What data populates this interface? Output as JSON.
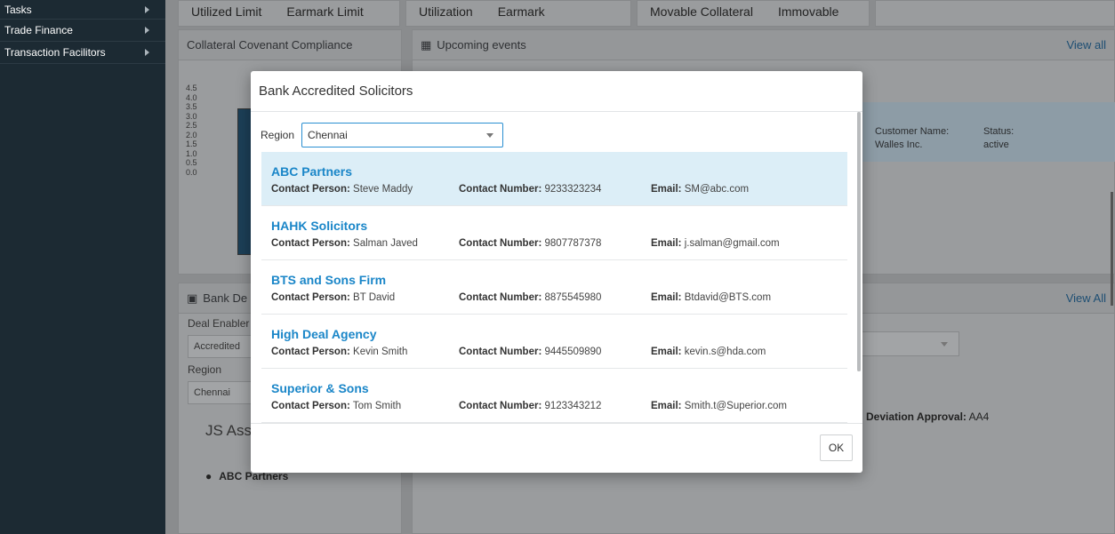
{
  "sidebar": {
    "items": [
      {
        "label": "Tasks"
      },
      {
        "label": "Trade Finance"
      },
      {
        "label": "Transaction Facilitors"
      }
    ]
  },
  "dashboard": {
    "tab_groups": [
      [
        "Utilized Limit",
        "Earmark Limit"
      ],
      [
        "Utilization",
        "Earmark"
      ],
      [
        "Movable Collateral",
        "Immovable"
      ]
    ],
    "collateral_panel_title": "Collateral Covenant Compliance",
    "chart_ticks": [
      "4.5",
      "4.0",
      "3.5",
      "3.0",
      "2.5",
      "2.0",
      "1.5",
      "1.0",
      "0.5",
      "0.0"
    ],
    "events_title": "Upcoming events",
    "events_view_all": "View all",
    "customer_name_label": "Customer Name:",
    "customer_name_value": "Walles Inc.",
    "status_label": "Status:",
    "status_value": "active",
    "bank_deals_title": "Bank De",
    "view_all_2": "View All",
    "deal_enabler_label": "Deal Enabler",
    "deal_enabler_value": "Accredited",
    "region_label": "Region",
    "region_value": "Chennai",
    "js_assoc": "JS Assoc",
    "abc_partners": "ABC Partners",
    "deviation_label": "Deviation Approval:",
    "deviation_value": "AA4"
  },
  "modal": {
    "title": "Bank Accredited Solicitors",
    "region_label": "Region",
    "region_selected": "Chennai",
    "contact_person_label": "Contact Person:",
    "contact_number_label": "Contact Number:",
    "email_label": "Email:",
    "ok_label": "OK",
    "solicitors": [
      {
        "name": "ABC Partners",
        "person": "Steve Maddy",
        "number": "9233323234",
        "email": "SM@abc.com"
      },
      {
        "name": "HAHK Solicitors",
        "person": "Salman Javed",
        "number": "9807787378",
        "email": "j.salman@gmail.com"
      },
      {
        "name": "BTS and Sons Firm",
        "person": "BT David",
        "number": "8875545980",
        "email": "Btdavid@BTS.com"
      },
      {
        "name": "High Deal Agency",
        "person": "Kevin Smith",
        "number": "9445509890",
        "email": "kevin.s@hda.com"
      },
      {
        "name": "Superior & Sons",
        "person": "Tom Smith",
        "number": "9123343212",
        "email": "Smith.t@Superior.com"
      }
    ]
  }
}
